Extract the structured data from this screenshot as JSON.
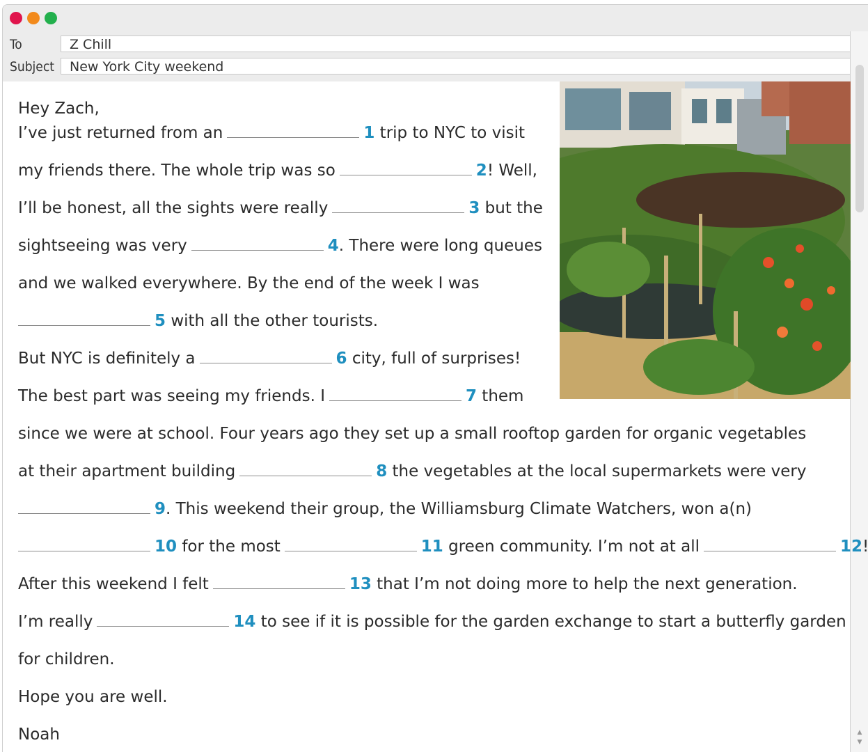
{
  "window": {
    "controls": [
      "close",
      "minimize",
      "maximize"
    ]
  },
  "email": {
    "to_label": "To",
    "to_value": "Z Chill",
    "subject_label": "Subject",
    "subject_value": "New York City weekend"
  },
  "body": {
    "greeting": "Hey Zach,",
    "l1a": "I’ve just returned from an",
    "n1": "1",
    "l1b": " trip to NYC to visit",
    "l2a": "my friends there. The whole trip was so",
    "n2": "2",
    "l2b": "! Well,",
    "l3a": "I’ll be honest, all the sights were really",
    "n3": "3",
    "l3b": " but the",
    "l4a": "sightseeing was very",
    "n4": "4",
    "l4b": ". There were long queues",
    "l5": "and we walked everywhere. By the end of the week I was",
    "n5": "5",
    "l6b": " with all the other tourists.",
    "l7a": "But NYC is definitely a",
    "n6": "6",
    "l7b": " city, full of surprises!",
    "l8a": "The best part was seeing my friends. I",
    "n7": "7",
    "l8b": " them",
    "l9": "since we were at school. Four years ago they set up a small rooftop garden for organic vegetables",
    "l10a": "at their apartment building",
    "n8": "8",
    "l10b": " the vegetables at the local supermarkets were very",
    "n9": "9",
    "l11b": ". This weekend their group, the Williamsburg Climate Watchers, won a(n)",
    "n10": "10",
    "l12a": " for the most",
    "n11": "11",
    "l12b": " green community. I’m not at all",
    "n12": "12",
    "l12c": "!",
    "l13a": "After this weekend I felt",
    "n13": "13",
    "l13b": " that I’m not doing more to help the next generation.",
    "l14a": "I’m really",
    "n14": "14",
    "l14b": " to see if it is possible for the garden exchange to start a butterfly garden",
    "l15": "for children.",
    "l16": "Hope you are well.",
    "signature": "Noah"
  },
  "image": {
    "subject": "rooftop vegetable garden"
  },
  "colors": {
    "number_accent": "#1f8fbf",
    "close": "#e0144c",
    "minimize": "#f28a1c",
    "maximize": "#23b04d"
  }
}
